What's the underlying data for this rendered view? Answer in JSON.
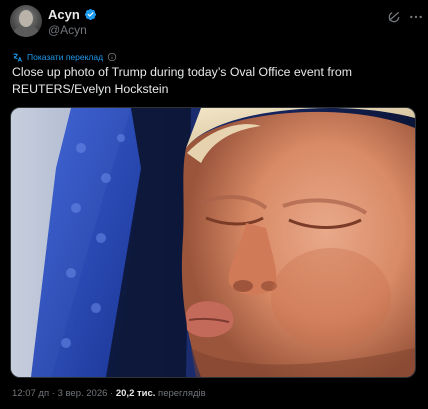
{
  "author": {
    "display_name": "Acyn",
    "handle": "@Acyn",
    "verified": true
  },
  "translate": {
    "link_label": "Показати переклад"
  },
  "tweet": {
    "text": "Close up photo of Trump during today’s Oval Office event from REUTERS/Evelyn Hockstein"
  },
  "meta": {
    "time": "12:07 дп",
    "separator": "·",
    "date": "3 вер. 2026",
    "separator2": "·",
    "views_count": "20,2 тис.",
    "views_label": "переглядів"
  },
  "icons": {
    "verified": "verified-badge-icon",
    "grok": "grok-icon",
    "more": "more-options-icon",
    "translate": "translate-icon",
    "info": "info-icon"
  },
  "colors": {
    "background": "#000000",
    "text_primary": "#e7e9ea",
    "text_secondary": "#71767b",
    "accent": "#1d9bf0"
  }
}
